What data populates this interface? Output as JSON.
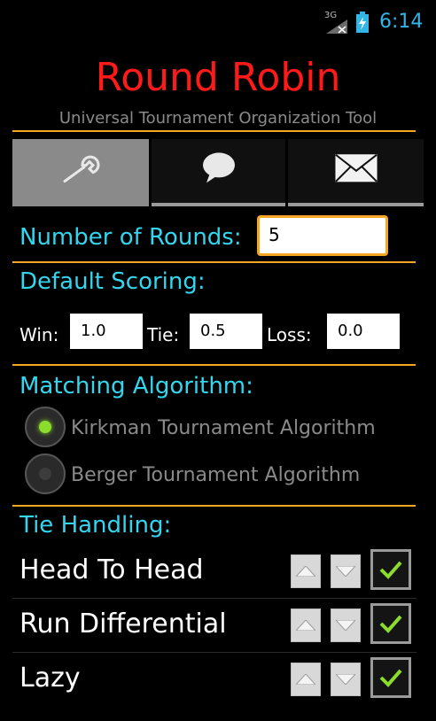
{
  "status_bar": {
    "network_label": "3G",
    "time": "6:14",
    "icons": [
      "signal-icon",
      "battery-charging-icon"
    ]
  },
  "header": {
    "title": "Round Robin",
    "subtitle": "Universal Tournament Organization Tool"
  },
  "tabs": [
    {
      "icon": "wrench-icon",
      "selected": true
    },
    {
      "icon": "speech-bubble-icon",
      "selected": false
    },
    {
      "icon": "envelope-icon",
      "selected": false
    }
  ],
  "rounds": {
    "label": "Number of Rounds:",
    "value": "5"
  },
  "scoring": {
    "label": "Default Scoring:",
    "win_label": "Win:",
    "win_value": "1.0",
    "tie_label": "Tie:",
    "tie_value": "0.5",
    "loss_label": "Loss:",
    "loss_value": "0.0"
  },
  "matching": {
    "label": "Matching Algorithm:",
    "options": [
      {
        "label": "Kirkman Tournament Algorithm",
        "selected": true
      },
      {
        "label": "Berger Tournament Algorithm",
        "selected": false
      }
    ]
  },
  "tie_handling": {
    "label": "Tie Handling:",
    "items": [
      {
        "label": "Head To Head",
        "checked": true
      },
      {
        "label": "Run Differential",
        "checked": true
      },
      {
        "label": "Lazy",
        "checked": true
      }
    ]
  },
  "colors": {
    "accent": "#f6a623",
    "title": "#ff1a1a",
    "section_label": "#33d6ee",
    "check": "#8bdc2c",
    "radio_selected": "#8bdc2c"
  }
}
